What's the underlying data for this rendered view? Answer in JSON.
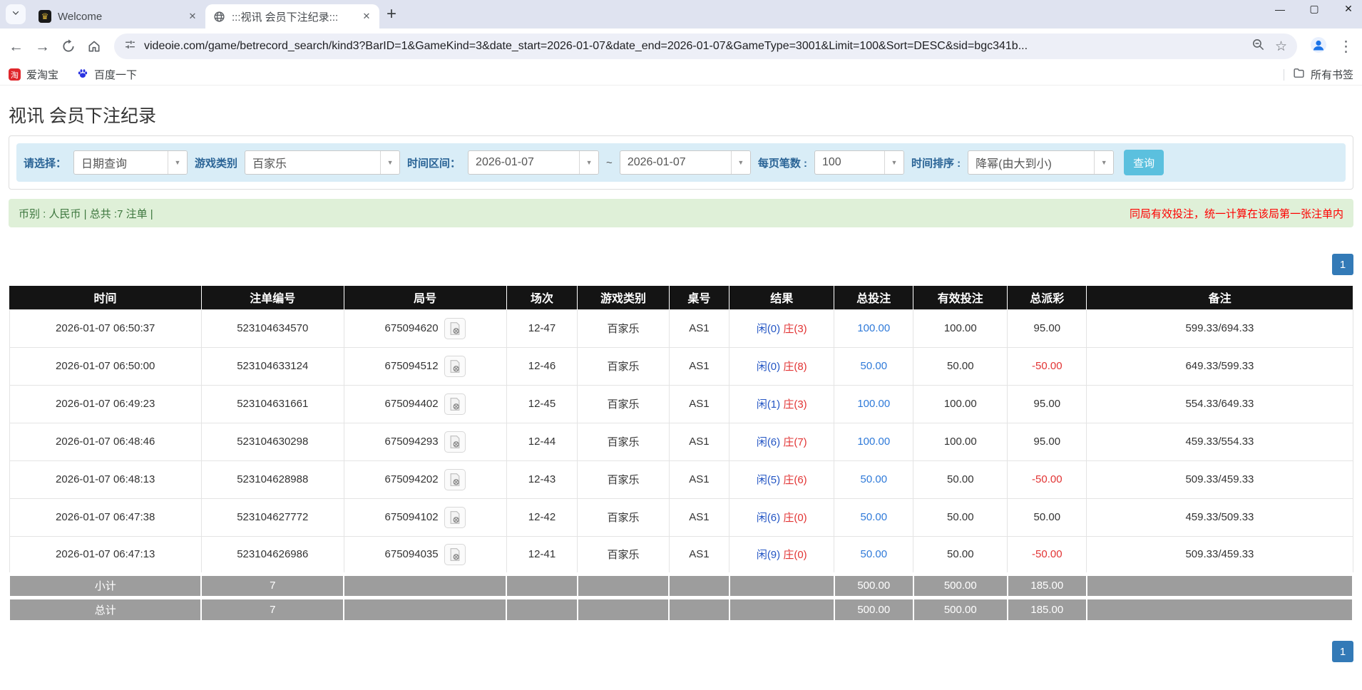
{
  "browser": {
    "tabs": [
      {
        "title": "Welcome",
        "active": false
      },
      {
        "title": ":::视讯 会员下注纪录:::",
        "active": true
      }
    ],
    "url": "videoie.com/game/betrecord_search/kind3?BarID=1&GameKind=3&date_start=2026-01-07&date_end=2026-01-07&GameType=3001&Limit=100&Sort=DESC&sid=bgc341b...",
    "bookmarks": {
      "taobao": "爱淘宝",
      "baidu": "百度一下",
      "all_bookmarks": "所有书签"
    },
    "glyphs": {
      "close": "✕",
      "minimize": "—",
      "maximize": "▢",
      "back": "←",
      "forward": "→",
      "new_tab": "+",
      "menu": "⋮",
      "star": "☆",
      "combo_arrow": "▼",
      "taobao_char": "淘",
      "crown": "♛"
    }
  },
  "page": {
    "title": "视讯 会员下注纪录",
    "filters": {
      "select_label": "请选择：",
      "select_value": "日期查询",
      "game_kind_label": "游戏类别",
      "game_kind_value": "百家乐",
      "date_range_label": "时间区间：",
      "date_start": "2026-01-07",
      "date_separator": "~",
      "date_end": "2026-01-07",
      "page_size_label": "每页笔数 :",
      "page_size_value": "100",
      "sort_label": "时间排序 :",
      "sort_value": "降幂(由大到小)",
      "search_button": "查询"
    },
    "info_bar": {
      "left": "币别 : 人民币 | 总共 :7 注单 |",
      "right": "同局有效投注，统一计算在该局第一张注单内"
    },
    "pagination": "1",
    "table": {
      "headers": [
        "时间",
        "注单编号",
        "局号",
        "场次",
        "游戏类别",
        "桌号",
        "结果",
        "总投注",
        "有效投注",
        "总派彩",
        "备注"
      ],
      "col_widths": [
        "14.3%",
        "10.6%",
        "12.1%",
        "5.3%",
        "6.8%",
        "4.5%",
        "7.8%",
        "5.9%",
        "7.0%",
        "5.9%",
        "19.8%"
      ],
      "rows": [
        {
          "time": "2026-01-07 06:50:37",
          "bet_id": "523104634570",
          "round_id": "675094620",
          "session": "12-47",
          "game": "百家乐",
          "table_no": "AS1",
          "player": "闲(0)",
          "banker": "庄(3)",
          "total_bet": "100.00",
          "valid_bet": "100.00",
          "payout": "95.00",
          "note": "599.33/694.33"
        },
        {
          "time": "2026-01-07 06:50:00",
          "bet_id": "523104633124",
          "round_id": "675094512",
          "session": "12-46",
          "game": "百家乐",
          "table_no": "AS1",
          "player": "闲(0)",
          "banker": "庄(8)",
          "total_bet": "50.00",
          "valid_bet": "50.00",
          "payout": "-50.00",
          "note": "649.33/599.33"
        },
        {
          "time": "2026-01-07 06:49:23",
          "bet_id": "523104631661",
          "round_id": "675094402",
          "session": "12-45",
          "game": "百家乐",
          "table_no": "AS1",
          "player": "闲(1)",
          "banker": "庄(3)",
          "total_bet": "100.00",
          "valid_bet": "100.00",
          "payout": "95.00",
          "note": "554.33/649.33"
        },
        {
          "time": "2026-01-07 06:48:46",
          "bet_id": "523104630298",
          "round_id": "675094293",
          "session": "12-44",
          "game": "百家乐",
          "table_no": "AS1",
          "player": "闲(6)",
          "banker": "庄(7)",
          "total_bet": "100.00",
          "valid_bet": "100.00",
          "payout": "95.00",
          "note": "459.33/554.33"
        },
        {
          "time": "2026-01-07 06:48:13",
          "bet_id": "523104628988",
          "round_id": "675094202",
          "session": "12-43",
          "game": "百家乐",
          "table_no": "AS1",
          "player": "闲(5)",
          "banker": "庄(6)",
          "total_bet": "50.00",
          "valid_bet": "50.00",
          "payout": "-50.00",
          "note": "509.33/459.33"
        },
        {
          "time": "2026-01-07 06:47:38",
          "bet_id": "523104627772",
          "round_id": "675094102",
          "session": "12-42",
          "game": "百家乐",
          "table_no": "AS1",
          "player": "闲(6)",
          "banker": "庄(0)",
          "total_bet": "50.00",
          "valid_bet": "50.00",
          "payout": "50.00",
          "note": "459.33/509.33"
        },
        {
          "time": "2026-01-07 06:47:13",
          "bet_id": "523104626986",
          "round_id": "675094035",
          "session": "12-41",
          "game": "百家乐",
          "table_no": "AS1",
          "player": "闲(9)",
          "banker": "庄(0)",
          "total_bet": "50.00",
          "valid_bet": "50.00",
          "payout": "-50.00",
          "note": "509.33/459.33"
        }
      ],
      "subtotal": {
        "label": "小计",
        "count": "7",
        "total_bet": "500.00",
        "valid_bet": "500.00",
        "payout": "185.00"
      },
      "total": {
        "label": "总计",
        "count": "7",
        "total_bet": "500.00",
        "valid_bet": "500.00",
        "payout": "185.00"
      }
    },
    "colors": {
      "accent_blue": "#337ab7",
      "search_btn": "#5bc0de",
      "filter_bg": "#d9edf7",
      "label_blue": "#2a6496",
      "info_bg": "#dff0d8",
      "info_text": "#3c763d",
      "alert_red": "#fe0000",
      "player_blue": "#2355c4",
      "banker_red": "#e23434",
      "header_bg": "#141414",
      "footer_bg": "#9d9d9d"
    }
  }
}
